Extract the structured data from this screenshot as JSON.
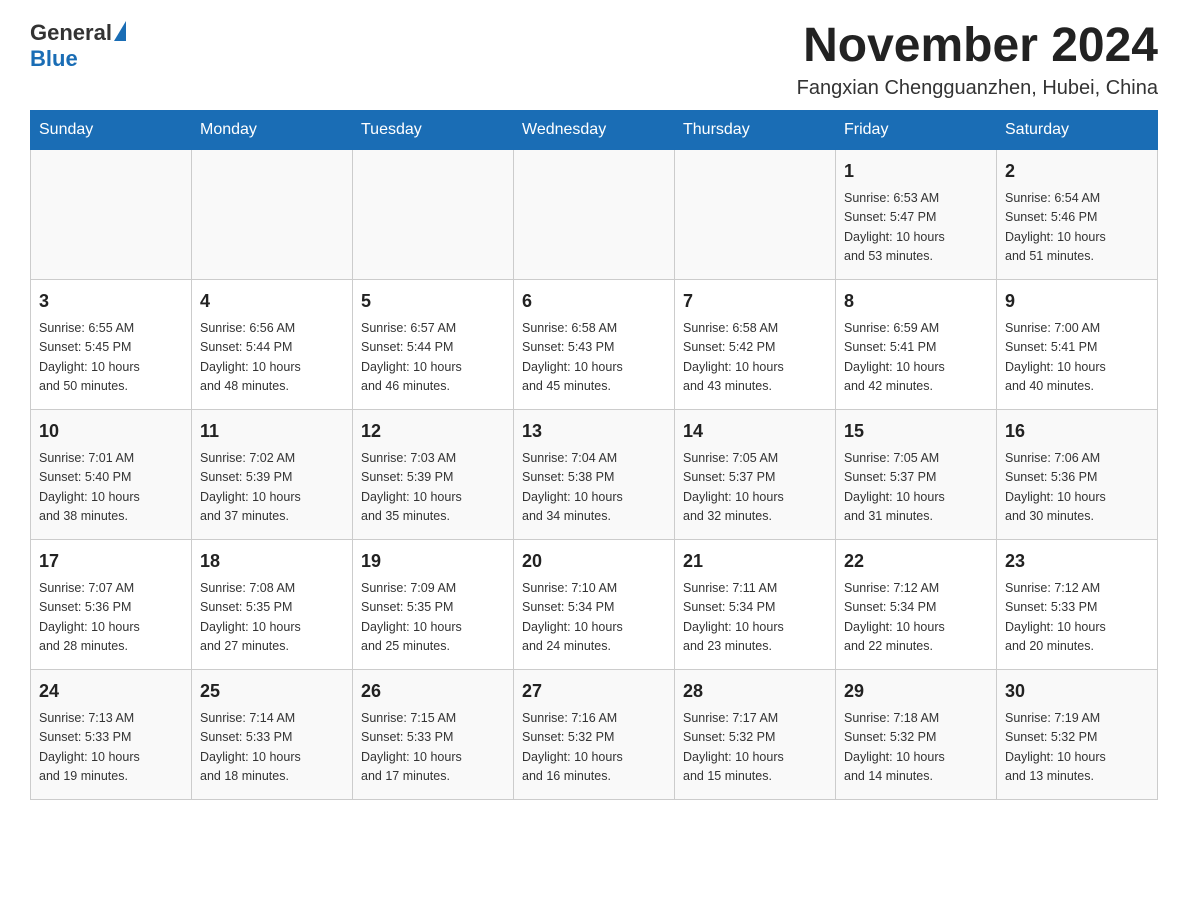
{
  "logo": {
    "text_general": "General",
    "text_blue": "Blue",
    "arrow_color": "#1a6db5"
  },
  "header": {
    "month_title": "November 2024",
    "location": "Fangxian Chengguanzhen, Hubei, China"
  },
  "days_of_week": [
    "Sunday",
    "Monday",
    "Tuesday",
    "Wednesday",
    "Thursday",
    "Friday",
    "Saturday"
  ],
  "weeks": [
    {
      "days": [
        {
          "num": "",
          "info": ""
        },
        {
          "num": "",
          "info": ""
        },
        {
          "num": "",
          "info": ""
        },
        {
          "num": "",
          "info": ""
        },
        {
          "num": "",
          "info": ""
        },
        {
          "num": "1",
          "info": "Sunrise: 6:53 AM\nSunset: 5:47 PM\nDaylight: 10 hours\nand 53 minutes."
        },
        {
          "num": "2",
          "info": "Sunrise: 6:54 AM\nSunset: 5:46 PM\nDaylight: 10 hours\nand 51 minutes."
        }
      ]
    },
    {
      "days": [
        {
          "num": "3",
          "info": "Sunrise: 6:55 AM\nSunset: 5:45 PM\nDaylight: 10 hours\nand 50 minutes."
        },
        {
          "num": "4",
          "info": "Sunrise: 6:56 AM\nSunset: 5:44 PM\nDaylight: 10 hours\nand 48 minutes."
        },
        {
          "num": "5",
          "info": "Sunrise: 6:57 AM\nSunset: 5:44 PM\nDaylight: 10 hours\nand 46 minutes."
        },
        {
          "num": "6",
          "info": "Sunrise: 6:58 AM\nSunset: 5:43 PM\nDaylight: 10 hours\nand 45 minutes."
        },
        {
          "num": "7",
          "info": "Sunrise: 6:58 AM\nSunset: 5:42 PM\nDaylight: 10 hours\nand 43 minutes."
        },
        {
          "num": "8",
          "info": "Sunrise: 6:59 AM\nSunset: 5:41 PM\nDaylight: 10 hours\nand 42 minutes."
        },
        {
          "num": "9",
          "info": "Sunrise: 7:00 AM\nSunset: 5:41 PM\nDaylight: 10 hours\nand 40 minutes."
        }
      ]
    },
    {
      "days": [
        {
          "num": "10",
          "info": "Sunrise: 7:01 AM\nSunset: 5:40 PM\nDaylight: 10 hours\nand 38 minutes."
        },
        {
          "num": "11",
          "info": "Sunrise: 7:02 AM\nSunset: 5:39 PM\nDaylight: 10 hours\nand 37 minutes."
        },
        {
          "num": "12",
          "info": "Sunrise: 7:03 AM\nSunset: 5:39 PM\nDaylight: 10 hours\nand 35 minutes."
        },
        {
          "num": "13",
          "info": "Sunrise: 7:04 AM\nSunset: 5:38 PM\nDaylight: 10 hours\nand 34 minutes."
        },
        {
          "num": "14",
          "info": "Sunrise: 7:05 AM\nSunset: 5:37 PM\nDaylight: 10 hours\nand 32 minutes."
        },
        {
          "num": "15",
          "info": "Sunrise: 7:05 AM\nSunset: 5:37 PM\nDaylight: 10 hours\nand 31 minutes."
        },
        {
          "num": "16",
          "info": "Sunrise: 7:06 AM\nSunset: 5:36 PM\nDaylight: 10 hours\nand 30 minutes."
        }
      ]
    },
    {
      "days": [
        {
          "num": "17",
          "info": "Sunrise: 7:07 AM\nSunset: 5:36 PM\nDaylight: 10 hours\nand 28 minutes."
        },
        {
          "num": "18",
          "info": "Sunrise: 7:08 AM\nSunset: 5:35 PM\nDaylight: 10 hours\nand 27 minutes."
        },
        {
          "num": "19",
          "info": "Sunrise: 7:09 AM\nSunset: 5:35 PM\nDaylight: 10 hours\nand 25 minutes."
        },
        {
          "num": "20",
          "info": "Sunrise: 7:10 AM\nSunset: 5:34 PM\nDaylight: 10 hours\nand 24 minutes."
        },
        {
          "num": "21",
          "info": "Sunrise: 7:11 AM\nSunset: 5:34 PM\nDaylight: 10 hours\nand 23 minutes."
        },
        {
          "num": "22",
          "info": "Sunrise: 7:12 AM\nSunset: 5:34 PM\nDaylight: 10 hours\nand 22 minutes."
        },
        {
          "num": "23",
          "info": "Sunrise: 7:12 AM\nSunset: 5:33 PM\nDaylight: 10 hours\nand 20 minutes."
        }
      ]
    },
    {
      "days": [
        {
          "num": "24",
          "info": "Sunrise: 7:13 AM\nSunset: 5:33 PM\nDaylight: 10 hours\nand 19 minutes."
        },
        {
          "num": "25",
          "info": "Sunrise: 7:14 AM\nSunset: 5:33 PM\nDaylight: 10 hours\nand 18 minutes."
        },
        {
          "num": "26",
          "info": "Sunrise: 7:15 AM\nSunset: 5:33 PM\nDaylight: 10 hours\nand 17 minutes."
        },
        {
          "num": "27",
          "info": "Sunrise: 7:16 AM\nSunset: 5:32 PM\nDaylight: 10 hours\nand 16 minutes."
        },
        {
          "num": "28",
          "info": "Sunrise: 7:17 AM\nSunset: 5:32 PM\nDaylight: 10 hours\nand 15 minutes."
        },
        {
          "num": "29",
          "info": "Sunrise: 7:18 AM\nSunset: 5:32 PM\nDaylight: 10 hours\nand 14 minutes."
        },
        {
          "num": "30",
          "info": "Sunrise: 7:19 AM\nSunset: 5:32 PM\nDaylight: 10 hours\nand 13 minutes."
        }
      ]
    }
  ]
}
